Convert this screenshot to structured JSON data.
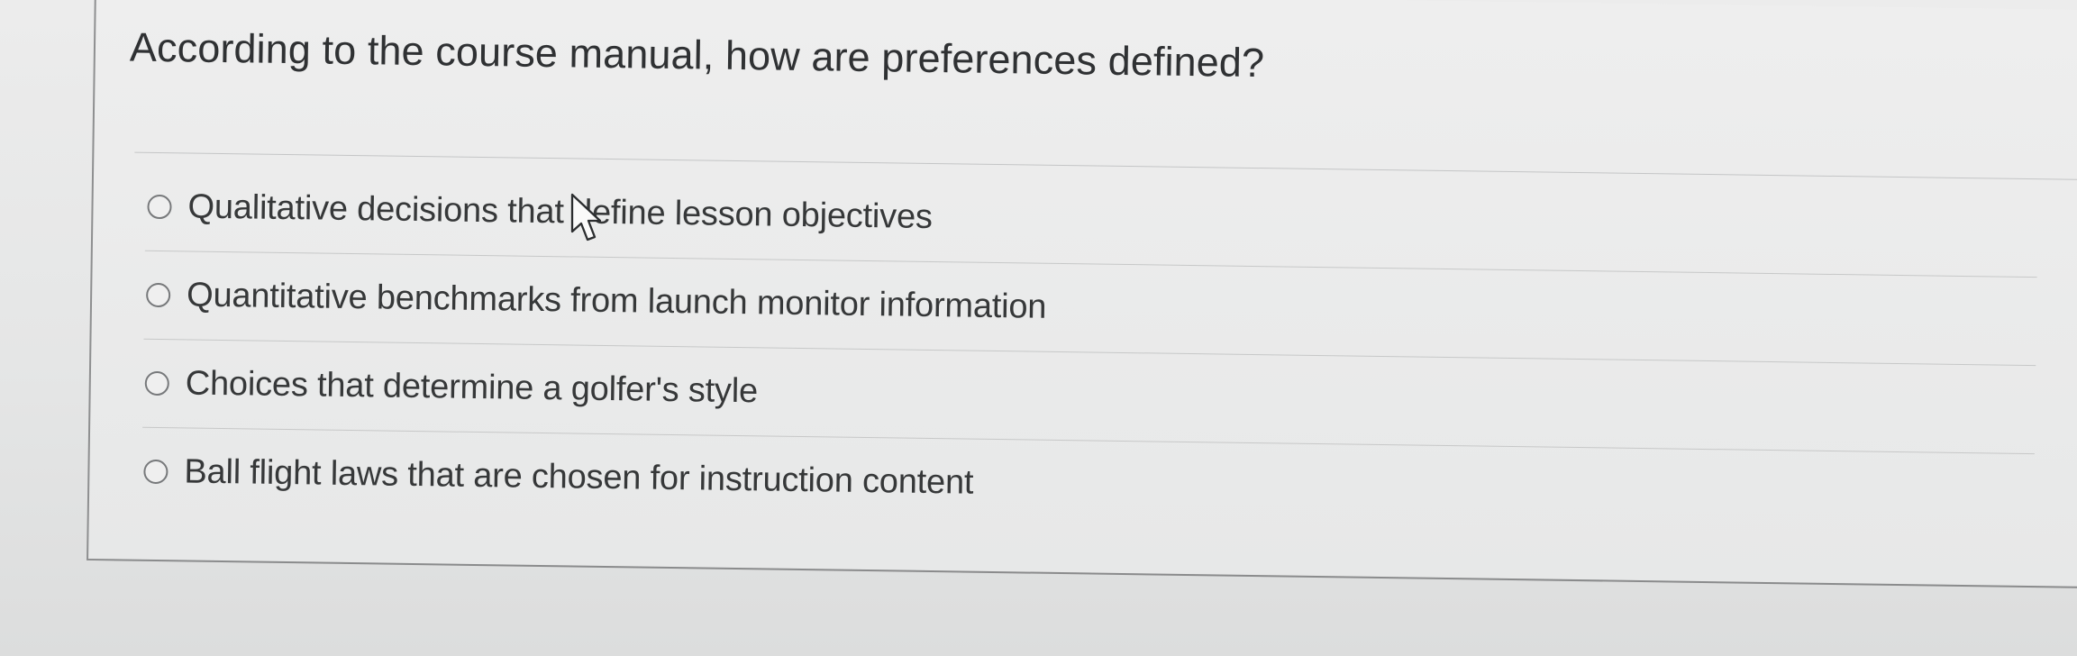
{
  "question": {
    "text": "According to the course manual, how are preferences defined?"
  },
  "answers": [
    {
      "label": "Qualitative decisions that define lesson objectives",
      "selected": false
    },
    {
      "label": "Quantitative benchmarks from launch monitor information",
      "selected": false
    },
    {
      "label": "Choices that determine a golfer's style",
      "selected": false
    },
    {
      "label": "Ball flight laws that are chosen for instruction content",
      "selected": false
    }
  ],
  "icons": {
    "radio": "radio-circle-icon",
    "cursor": "mouse-pointer-icon"
  },
  "colors": {
    "background": "#e7e8e8",
    "text": "#333537",
    "divider": "#c6c7c8",
    "radio_border": "#77797b"
  }
}
